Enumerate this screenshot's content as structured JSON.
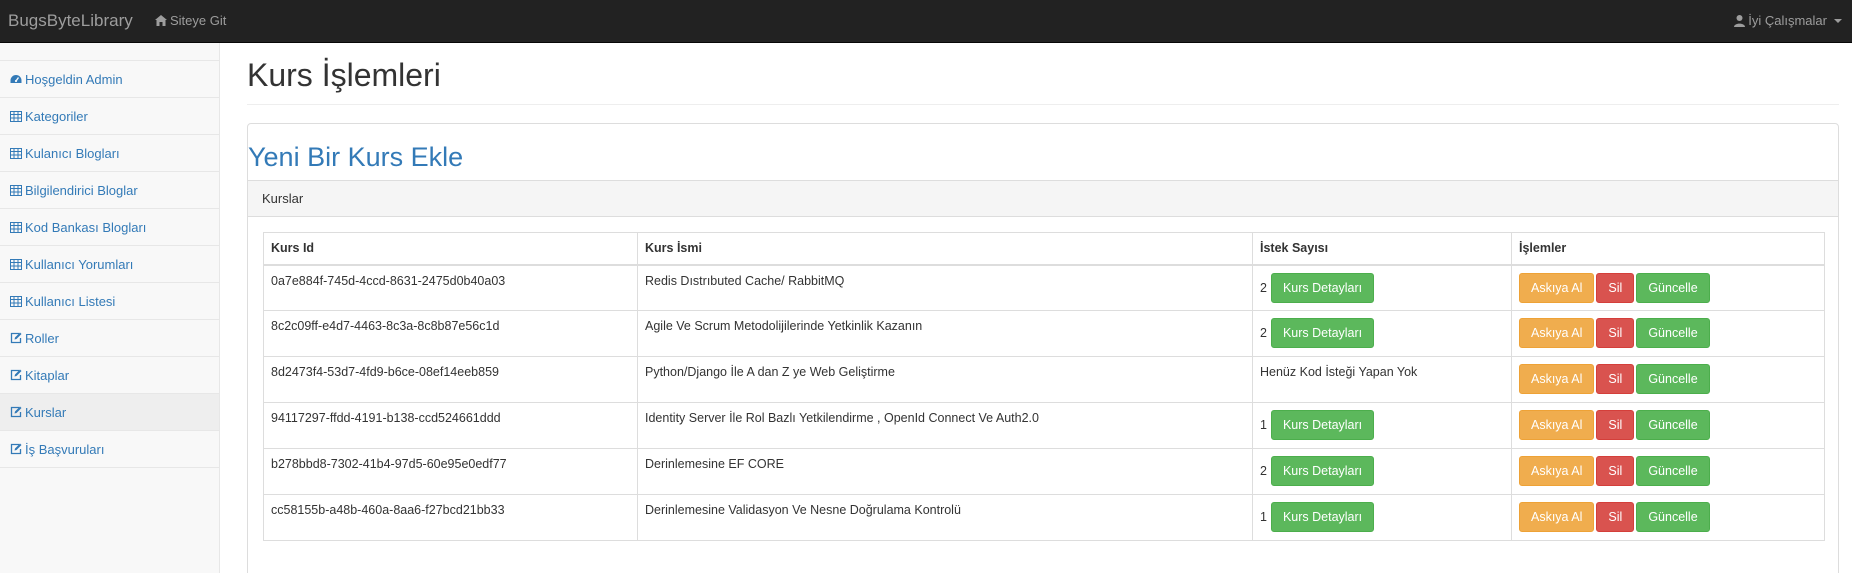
{
  "navbar": {
    "brand": "BugsByteLibrary",
    "site_link": "Siteye Git",
    "user_menu": "İyi Çalışmalar"
  },
  "sidebar": {
    "items": [
      {
        "label": "Hoşgeldin Admin",
        "icon": "dashboard-icon"
      },
      {
        "label": "Kategoriler",
        "icon": "table-icon"
      },
      {
        "label": "Kulanıcı Blogları",
        "icon": "table-icon"
      },
      {
        "label": "Bilgilendirici Bloglar",
        "icon": "table-icon"
      },
      {
        "label": "Kod Bankası Blogları",
        "icon": "table-icon"
      },
      {
        "label": "Kullanıcı Yorumları",
        "icon": "table-icon"
      },
      {
        "label": "Kullanıcı Listesi",
        "icon": "table-icon"
      },
      {
        "label": "Roller",
        "icon": "edit-icon"
      },
      {
        "label": "Kitaplar",
        "icon": "edit-icon"
      },
      {
        "label": "Kurslar",
        "icon": "edit-icon",
        "active": true
      },
      {
        "label": "İş Başvuruları",
        "icon": "edit-icon"
      }
    ]
  },
  "main": {
    "page_title": "Kurs İşlemleri",
    "add_link": "Yeni Bir Kurs Ekle",
    "panel_heading": "Kurslar",
    "table": {
      "headers": [
        "Kurs Id",
        "Kurs İsmi",
        "İstek Sayısı",
        "İşlemler"
      ],
      "rows": [
        {
          "id": "0a7e884f-745d-4ccd-8631-2475d0b40a03",
          "name": "Redis Dıstrıbuted Cache/ RabbitMQ",
          "count": "2",
          "has_details": true
        },
        {
          "id": "8c2c09ff-e4d7-4463-8c3a-8c8b87e56c1d",
          "name": "Agile Ve Scrum Metodolijilerinde Yetkinlik Kazanın",
          "count": "2",
          "has_details": true
        },
        {
          "id": "8d2473f4-53d7-4fd9-b6ce-08ef14eeb859",
          "name": "Python/Django İle A dan Z ye Web Geliştirme",
          "count": "Henüz Kod İsteği Yapan Yok",
          "has_details": false
        },
        {
          "id": "94117297-ffdd-4191-b138-ccd524661ddd",
          "name": "Identity Server İle Rol Bazlı Yetkilendirme , OpenId Connect Ve Auth2.0",
          "count": "1",
          "has_details": true
        },
        {
          "id": "b278bbd8-7302-41b4-97d5-60e95e0edf77",
          "name": "Derinlemesine EF CORE",
          "count": "2",
          "has_details": true
        },
        {
          "id": "cc58155b-a48b-460a-8aa6-f27bcd21bb33",
          "name": "Derinlemesine Validasyon Ve Nesne Doğrulama Kontrolü",
          "count": "1",
          "has_details": true
        }
      ]
    },
    "buttons": {
      "details": "Kurs Detayları",
      "suspend": "Askıya Al",
      "delete": "Sil",
      "update": "Güncelle"
    }
  }
}
